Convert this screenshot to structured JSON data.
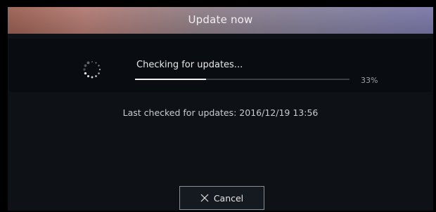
{
  "dialog": {
    "title": "Update now",
    "status_text": "Checking for updates...",
    "progress_label": "33%",
    "progress": 0.33,
    "last_checked": "Last checked for updates: 2016/12/19 13:56",
    "cancel_label": "Cancel",
    "icons": {
      "spinner": "loading-spinner-icon",
      "cancel": "close-icon"
    }
  }
}
